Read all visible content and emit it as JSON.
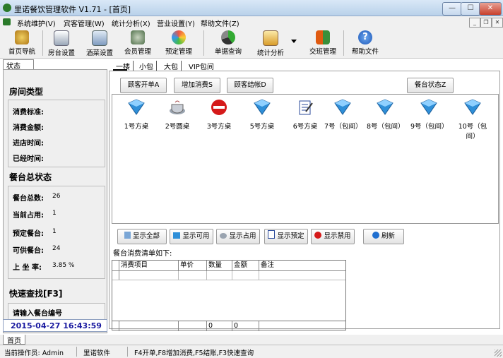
{
  "window": {
    "title": "里诺餐饮管理软件 V1.71 - [首页]"
  },
  "menu": [
    "系统维护(V)",
    "宾客管理(W)",
    "统计分析(X)",
    "营业设置(Y)",
    "帮助文件(Z)"
  ],
  "toolbar": {
    "items": [
      "首页导航",
      "房台设置",
      "酒菜设置",
      "会员管理",
      "预定管理",
      "单据查询",
      "统计分析",
      "交班管理",
      "帮助文件"
    ]
  },
  "left": {
    "tab": "状态",
    "room_type_title": "房间类型",
    "room_fields": [
      "消费标准:",
      "消费金额:",
      "进店时间:",
      "已经时间:"
    ],
    "summary_title": "餐台总状态",
    "summary": [
      {
        "label": "餐台总数:",
        "value": "26"
      },
      {
        "label": "当前占用:",
        "value": "1"
      },
      {
        "label": "预定餐台:",
        "value": "1"
      },
      {
        "label": "可供餐台:",
        "value": "24"
      },
      {
        "label": "上 坐 率:",
        "value": "3.85 %"
      }
    ],
    "quick_title": "快速查找[F3]",
    "quick_placeholder": "请输入餐台编号",
    "datetime": "2015-04-27  16:43:59"
  },
  "main": {
    "tabs": [
      "一楼",
      "小包",
      "大包",
      "VIP包间"
    ],
    "actions": [
      "顾客开单A",
      "增加消费S",
      "顾客结帐D"
    ],
    "status_button": "餐台状态Z",
    "tables": [
      {
        "name": "1号方桌",
        "status": "free"
      },
      {
        "name": "2号圆桌",
        "status": "occupied"
      },
      {
        "name": "3号方桌",
        "status": "disabled"
      },
      {
        "name": "5号方桌",
        "status": "free"
      },
      {
        "name": "6号方桌",
        "status": "reserved"
      },
      {
        "name": "7号（包间）",
        "status": "free"
      },
      {
        "name": "8号（包间）",
        "status": "free"
      },
      {
        "name": "9号（包间）",
        "status": "free"
      },
      {
        "name": "10号（包间）",
        "status": "free"
      }
    ],
    "filters": [
      "显示全部",
      "显示可用",
      "显示占用",
      "显示预定",
      "显示禁用",
      "刷新"
    ],
    "list_title": "餐台消费清单如下:",
    "grid_headers": [
      "消费项目",
      "单价",
      "数量",
      "金额",
      "备注"
    ],
    "grid_totals": {
      "qty": "0",
      "amount": "0"
    }
  },
  "bottom_tab": "首页",
  "status": {
    "operator": "当前操作员: Admin",
    "company": "里诺软件",
    "hints": "F4开单,F8增加消费,F5结账,F3快速查询"
  },
  "colors": {
    "accent": "#1a1aa0",
    "free": "#2f8fd8",
    "disabled": "#d51a1a"
  }
}
